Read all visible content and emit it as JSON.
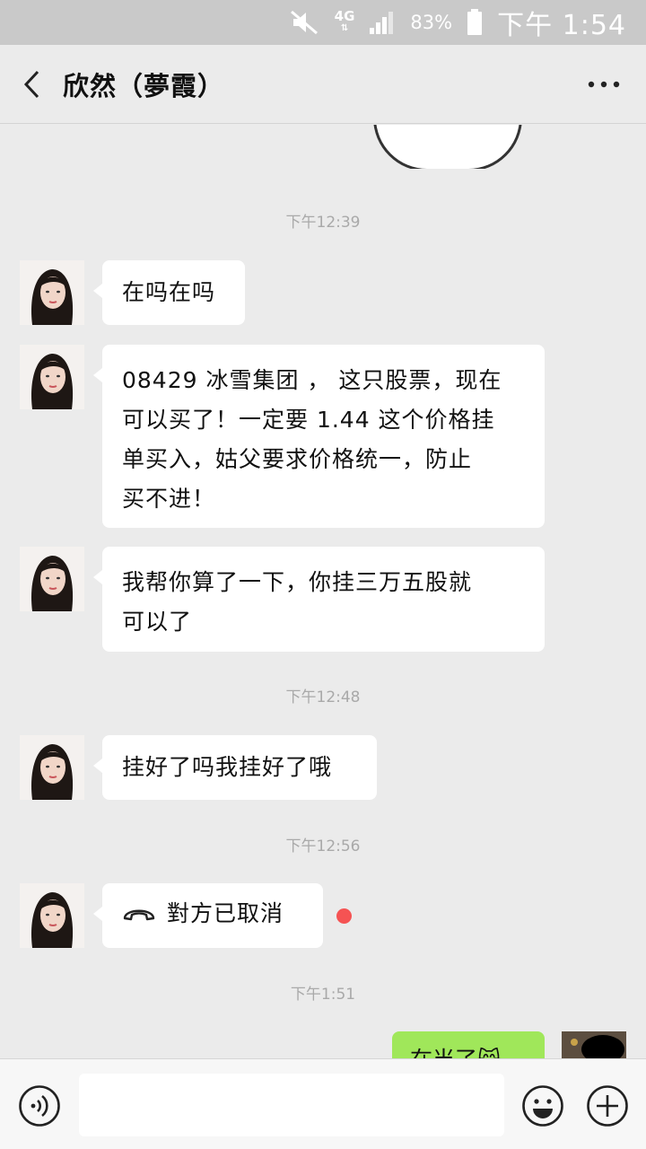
{
  "status_bar": {
    "network": "4G",
    "battery": "83%",
    "time": "下午 1:54"
  },
  "header": {
    "title": "欣然（夢霞）"
  },
  "messages": [
    {
      "type": "timestamp",
      "text": "下午12:39"
    },
    {
      "type": "incoming",
      "text": "在吗在吗"
    },
    {
      "type": "incoming",
      "lines": [
        "08429 冰雪集团 ， 这只股票，现在",
        "可以买了！一定要 1.44 这个价格挂",
        "单买入，姑父要求价格统一，防止",
        "买不进！"
      ]
    },
    {
      "type": "incoming",
      "lines": [
        "我帮你算了一下，你挂三万五股就",
        "可以了"
      ]
    },
    {
      "type": "timestamp",
      "text": "下午12:48"
    },
    {
      "type": "incoming",
      "text": "挂好了吗我挂好了哦"
    },
    {
      "type": "timestamp",
      "text": "下午12:56"
    },
    {
      "type": "incoming_call",
      "text": "對方已取消"
    },
    {
      "type": "timestamp",
      "text": "下午1:51"
    },
    {
      "type": "outgoing",
      "text": "在当了😸"
    }
  ],
  "colors": {
    "background": "#ebebeb",
    "incoming_bubble": "#ffffff",
    "outgoing_bubble": "#a0e75a",
    "unread_dot": "#f55353",
    "timestamp_text": "#a9a9a9"
  },
  "input_bar": {
    "placeholder": ""
  }
}
